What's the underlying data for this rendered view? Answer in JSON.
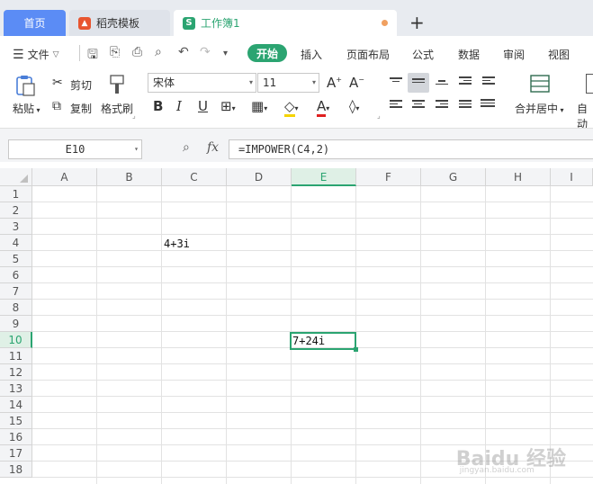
{
  "tabs": {
    "home": "首页",
    "docer": "稻壳模板",
    "workbook": "工作簿1",
    "new_tab": "+"
  },
  "menu": {
    "file": "文件",
    "start": "开始",
    "insert": "插入",
    "page_layout": "页面布局",
    "formulas": "公式",
    "data": "数据",
    "review": "审阅",
    "view": "视图"
  },
  "ribbon": {
    "paste": "粘贴",
    "cut": "剪切",
    "copy": "复制",
    "format_painter": "格式刷",
    "font_name": "宋体",
    "font_size": "11",
    "bold": "B",
    "italic": "I",
    "underline": "U",
    "merge_center": "合并居中",
    "auto_wrap": "自动"
  },
  "formula_bar": {
    "name_box": "E10",
    "fx": "fx",
    "formula": "=IMPOWER(C4,2)"
  },
  "grid": {
    "columns": [
      "A",
      "B",
      "C",
      "D",
      "E",
      "F",
      "G",
      "H",
      "I"
    ],
    "rows": [
      "1",
      "2",
      "3",
      "4",
      "5",
      "6",
      "7",
      "8",
      "9",
      "10",
      "11",
      "12",
      "13",
      "14",
      "15",
      "16",
      "17",
      "18"
    ],
    "active_column": "E",
    "active_row": "10",
    "cells": {
      "C4": "4+3i",
      "E10": "7+24i"
    }
  },
  "colors": {
    "accent": "#2ba471",
    "home_tab": "#5b8cf5"
  },
  "watermark": {
    "brand": "Baidu 经验",
    "url": "jingyan.baidu.com"
  }
}
